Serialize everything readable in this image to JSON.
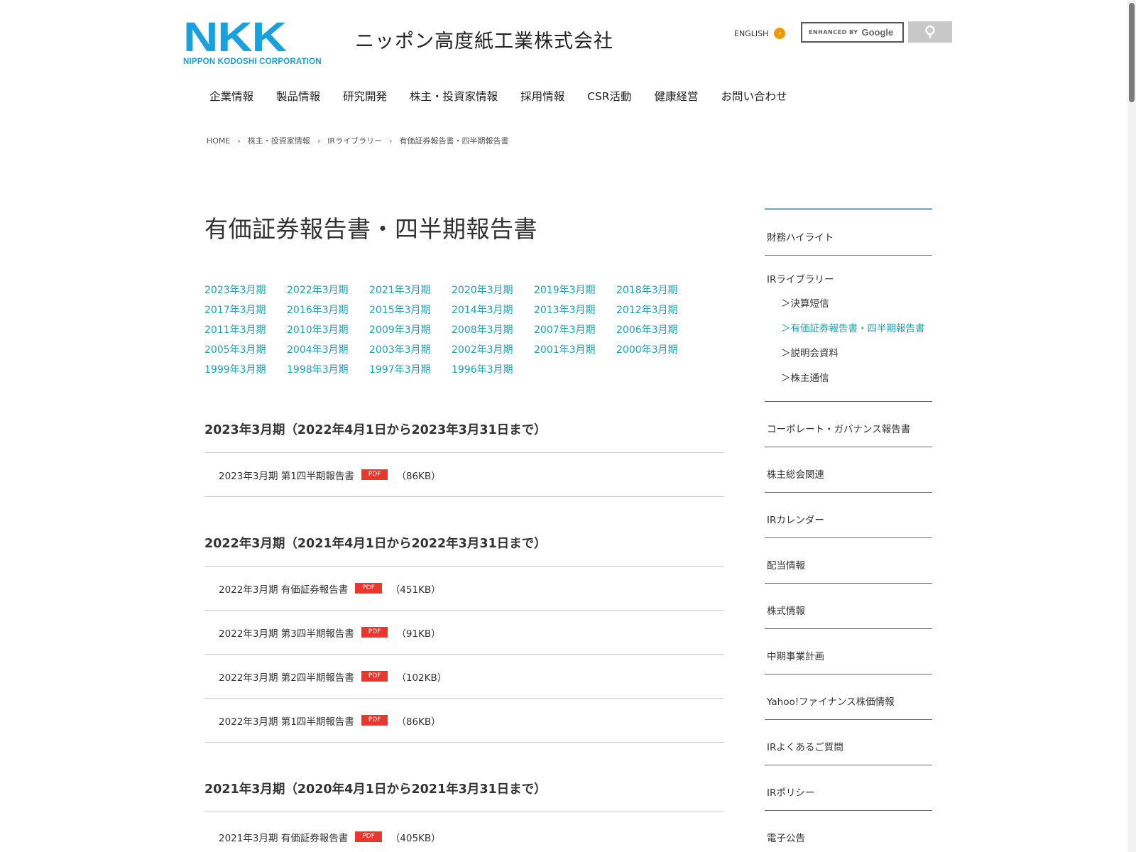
{
  "header": {
    "logo_mark": "NKK",
    "logo_sub": "NIPPON KODOSHI CORPORATION",
    "company_name": "ニッポン高度紙工業株式会社",
    "english_label": "ENGLISH",
    "search_enhanced": "ENHANCED BY",
    "search_google": "Google"
  },
  "nav": [
    "企業情報",
    "製品情報",
    "研究開発",
    "株主・投資家情報",
    "採用情報",
    "CSR活動",
    "健康経営",
    "お問い合わせ"
  ],
  "breadcrumb": [
    "HOME",
    "株主・投資家情報",
    "IRライブラリー",
    "有価証券報告書・四半期報告書"
  ],
  "page_title": "有価証券報告書・四半期報告書",
  "year_links": [
    "2023年3月期",
    "2022年3月期",
    "2021年3月期",
    "2020年3月期",
    "2019年3月期",
    "2018年3月期",
    "2017年3月期",
    "2016年3月期",
    "2015年3月期",
    "2014年3月期",
    "2013年3月期",
    "2012年3月期",
    "2011年3月期",
    "2010年3月期",
    "2009年3月期",
    "2008年3月期",
    "2007年3月期",
    "2006年3月期",
    "2005年3月期",
    "2004年3月期",
    "2003年3月期",
    "2002年3月期",
    "2001年3月期",
    "2000年3月期",
    "1999年3月期",
    "1998年3月期",
    "1997年3月期",
    "1996年3月期"
  ],
  "pdf_label": "PDF",
  "sections": [
    {
      "heading": "2023年3月期（2022年4月1日から2023年3月31日まで）",
      "docs": [
        {
          "name": "2023年3月期 第1四半期報告書",
          "size": "（86KB）"
        }
      ]
    },
    {
      "heading": "2022年3月期（2021年4月1日から2022年3月31日まで）",
      "docs": [
        {
          "name": "2022年3月期 有価証券報告書",
          "size": "（451KB）"
        },
        {
          "name": "2022年3月期 第3四半期報告書",
          "size": "（91KB）"
        },
        {
          "name": "2022年3月期 第2四半期報告書",
          "size": "（102KB）"
        },
        {
          "name": "2022年3月期 第1四半期報告書",
          "size": "（86KB）"
        }
      ]
    },
    {
      "heading": "2021年3月期（2020年4月1日から2021年3月31日まで）",
      "docs": [
        {
          "name": "2021年3月期 有価証券報告書",
          "size": "（405KB）"
        }
      ]
    }
  ],
  "sidebar": {
    "item_top": "財務ハイライト",
    "group_title": "IRライブラリー",
    "group_items": [
      "決算短信",
      "有価証券報告書・四半期報告書",
      "説明会資料",
      "株主通信"
    ],
    "sub_marker": "＞",
    "items": [
      "コーポレート・ガバナンス報告書",
      "株主総会関連",
      "IRカレンダー",
      "配当情報",
      "株式情報",
      "中期事業計画",
      "Yahoo!ファイナンス株価情報",
      "IRよくあるご質問",
      "IRポリシー",
      "電子公告"
    ]
  },
  "colors": {
    "brand_blue": "#1aa0dd",
    "link_teal": "#1aa3b3",
    "pdf_red": "#e8372b",
    "english_orange": "#f39800",
    "sidebar_accent": "#6ec8cf"
  }
}
